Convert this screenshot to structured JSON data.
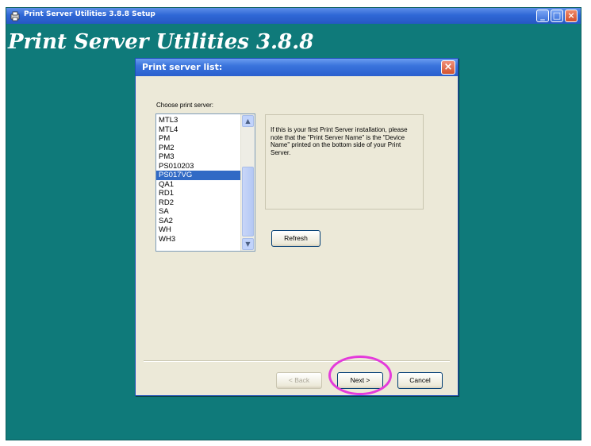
{
  "outer_window": {
    "title": "Print Server Utilities 3.8.8 Setup",
    "banner": "Print Server Utilities 3.8.8",
    "background_color": "#0f7a7a",
    "minimize_icon": "minimize-icon",
    "maximize_icon": "maximize-icon",
    "close_icon": "close-icon"
  },
  "dialog": {
    "title": "Print server list:",
    "close_icon": "close-icon",
    "choose_label": "Choose print server:",
    "servers": [
      "MTL3",
      "MTL4",
      "PM",
      "PM2",
      "PM3",
      "PS010203",
      "PS017VG",
      "QA1",
      "RD1",
      "RD2",
      "SA",
      "SA2",
      "WH",
      "WH3"
    ],
    "selected_server": "PS017VG",
    "info_text": "If this is your first Print Server installation, please note that the \"Print Server Name\" is the \"Device Name\" printed on the bottom side of your Print Server.",
    "buttons": {
      "refresh": "Refresh",
      "back": "< Back",
      "next": "Next >",
      "cancel": "Cancel"
    },
    "highlight_color": "#e43adb"
  }
}
